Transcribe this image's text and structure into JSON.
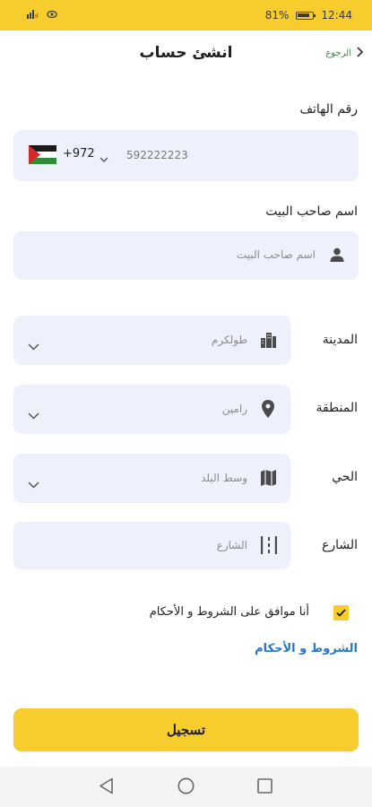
{
  "status_bar": {
    "battery_percent": "81%",
    "time": "12:44"
  },
  "header": {
    "back_label": "الرجوع",
    "title": "انشئ حساب"
  },
  "phone": {
    "label": "رقم الهاتف",
    "value": "592222223",
    "country_code": "+972",
    "flag": "palestine-flag"
  },
  "owner_name": {
    "label": "اسم صاحب البيت",
    "placeholder": "اسم صاحب البيت"
  },
  "address": {
    "city": {
      "label": "المدينة",
      "value": "طولكرم",
      "icon": "city-buildings-icon"
    },
    "region": {
      "label": "المنطقة",
      "value": "رامين",
      "icon": "location-pin-icon"
    },
    "neighborhood": {
      "label": "الحي",
      "value": "وسط البلد",
      "icon": "map-icon"
    },
    "street": {
      "label": "الشارع",
      "placeholder": "الشارع",
      "icon": "street-icon"
    }
  },
  "terms": {
    "agree_text": "أنا موافق على الشروط و الأحكام",
    "checked": true,
    "link_text": "الشروط و الأحكام"
  },
  "submit": {
    "label": "تسجيل"
  },
  "colors": {
    "accent": "#f7cc2d",
    "field_bg": "#eef0fc",
    "link": "#2477c9",
    "back": "#3b8a3b"
  }
}
